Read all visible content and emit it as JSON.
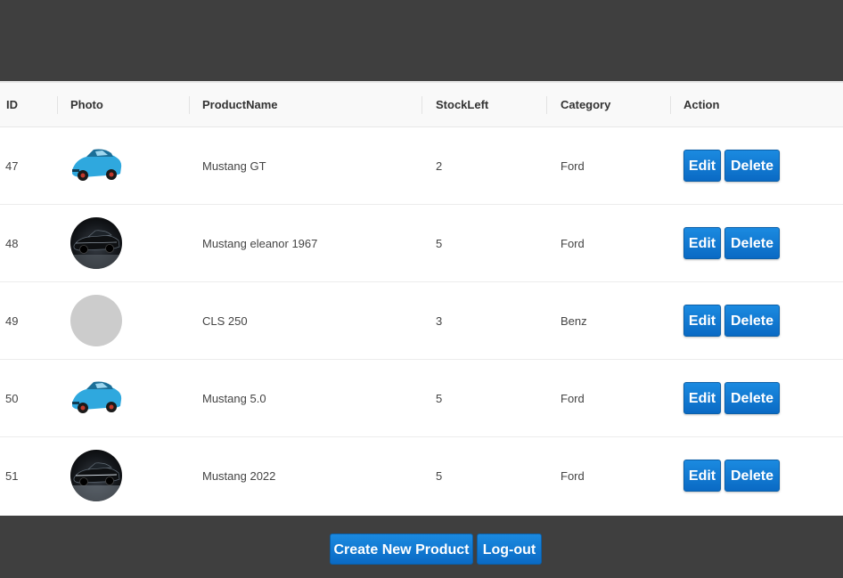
{
  "table": {
    "headers": {
      "id": "ID",
      "photo": "Photo",
      "name": "ProductName",
      "stock": "StockLeft",
      "category": "Category",
      "action": "Action"
    },
    "rows": [
      {
        "id": "47",
        "photo": "blue-mustang-image",
        "name": "Mustang GT",
        "stock": "2",
        "category": "Ford"
      },
      {
        "id": "48",
        "photo": "dark-mustang-image",
        "name": "Mustang eleanor 1967",
        "stock": "5",
        "category": "Ford"
      },
      {
        "id": "49",
        "photo": "placeholder-image",
        "name": "CLS 250",
        "stock": "3",
        "category": "Benz"
      },
      {
        "id": "50",
        "photo": "blue-mustang-image",
        "name": "Mustang 5.0",
        "stock": "5",
        "category": "Ford"
      },
      {
        "id": "51",
        "photo": "dark-mustang-image",
        "name": "Mustang 2022",
        "stock": "5",
        "category": "Ford"
      }
    ],
    "edit_label": "Edit",
    "delete_label": "Delete"
  },
  "footer": {
    "create_label": "Create New Product",
    "logout_label": "Log-out"
  },
  "colors": {
    "background": "#3f3f3f",
    "button": "#0a6ac4",
    "placeholder": "#cccccc"
  }
}
